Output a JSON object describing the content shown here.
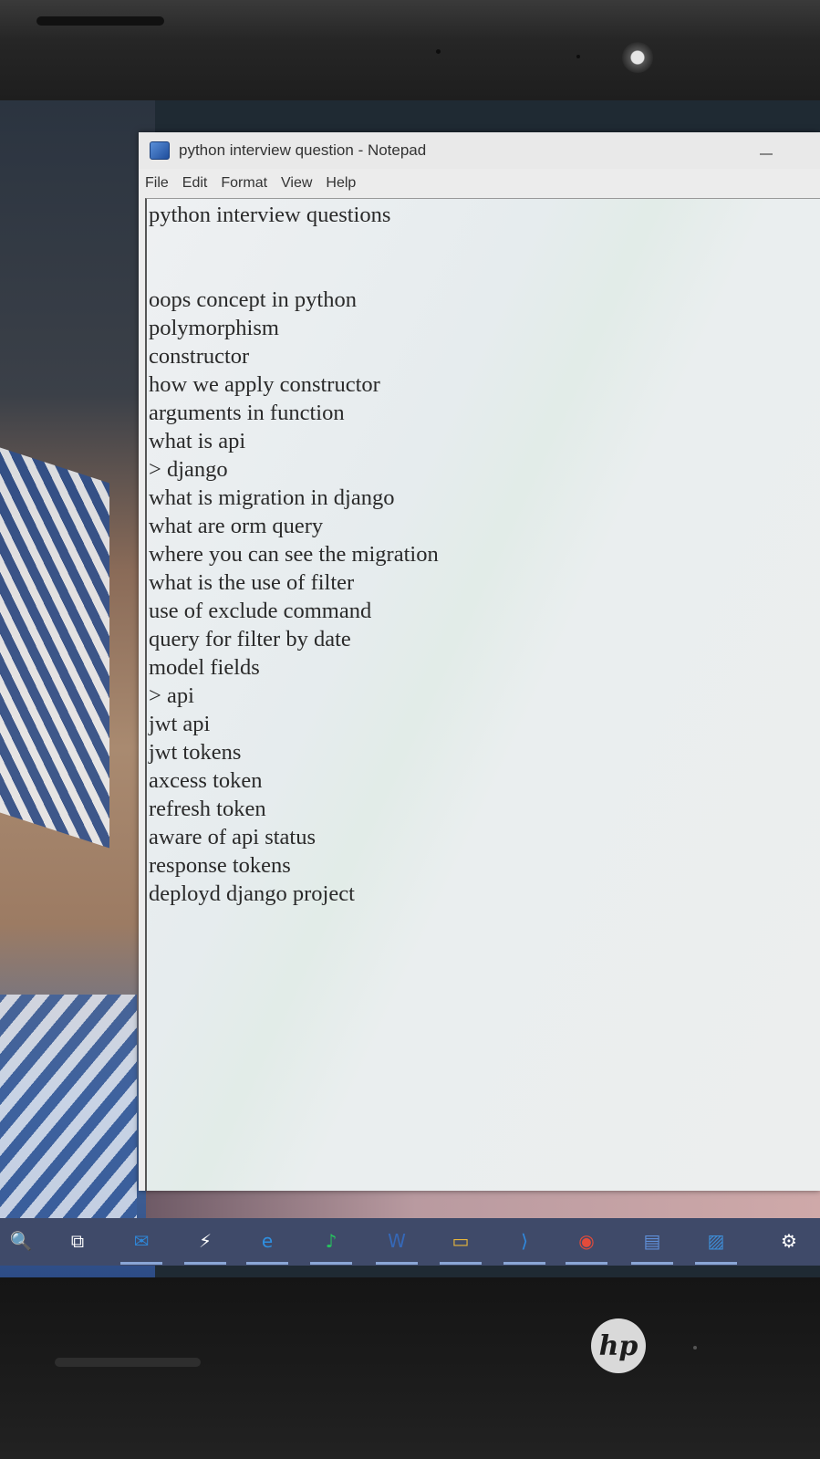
{
  "window": {
    "title": "python interview question - Notepad",
    "menu": [
      "File",
      "Edit",
      "Format",
      "View",
      "Help"
    ]
  },
  "document": {
    "heading": "python interview questions",
    "lines": [
      "oops concept in python",
      "polymorphism",
      "constructor",
      "how we apply constructor",
      "arguments in function",
      "what is api",
      "> django",
      "what is migration in django",
      "what are orm query",
      "where you can see the migration",
      "what is the use of filter",
      "use of exclude command",
      "query for filter by date",
      "model fields",
      "> api",
      "jwt api",
      "jwt tokens",
      "axcess token",
      "refresh token",
      "aware of api status",
      "response tokens",
      "deployd django project"
    ]
  },
  "taskbar": {
    "icons": [
      {
        "name": "search-icon",
        "glyph": "🔍",
        "color": "#f3c04d"
      },
      {
        "name": "task-view-icon",
        "glyph": "⧉",
        "color": "#ffffff"
      },
      {
        "name": "mail-icon",
        "glyph": "✉",
        "color": "#2f86d6"
      },
      {
        "name": "bolt-icon",
        "glyph": "⚡",
        "color": "#ffffff"
      },
      {
        "name": "edge-icon",
        "glyph": "e",
        "color": "#2f8fe0"
      },
      {
        "name": "spotify-icon",
        "glyph": "♪",
        "color": "#26c35e"
      },
      {
        "name": "word-icon",
        "glyph": "W",
        "color": "#3568b8"
      },
      {
        "name": "file-explorer-icon",
        "glyph": "▭",
        "color": "#e7b63b"
      },
      {
        "name": "vscode-icon",
        "glyph": "⟩",
        "color": "#2f8ae0"
      },
      {
        "name": "chrome-icon",
        "glyph": "◉",
        "color": "#e34b3a"
      },
      {
        "name": "store-icon",
        "glyph": "▤",
        "color": "#5f8fd8"
      },
      {
        "name": "photos-icon",
        "glyph": "▨",
        "color": "#3e8dd6"
      },
      {
        "name": "settings-icon",
        "glyph": "⚙",
        "color": "#ffffff"
      }
    ]
  },
  "hardware": {
    "brand_logo": "hp"
  }
}
